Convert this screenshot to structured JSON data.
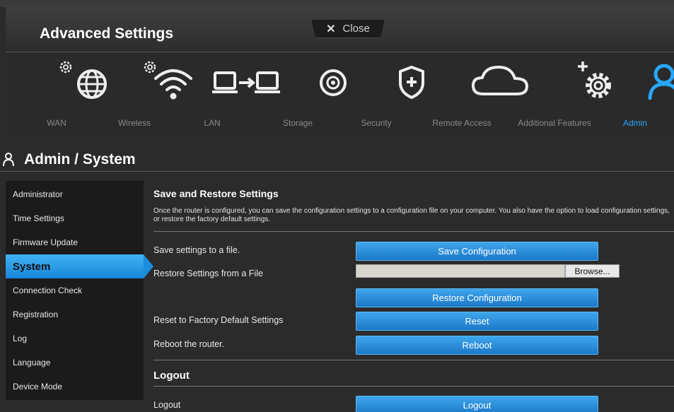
{
  "header": {
    "title": "Advanced Settings",
    "close_label": "Close",
    "close_glyph": "✕"
  },
  "nav": [
    {
      "label": "WAN",
      "icon": "globe-gear-icon",
      "active": false
    },
    {
      "label": "Wireless",
      "icon": "wifi-gear-icon",
      "active": false
    },
    {
      "label": "LAN",
      "icon": "lan-transfer-icon",
      "active": false
    },
    {
      "label": "Storage",
      "icon": "storage-disc-icon",
      "active": false
    },
    {
      "label": "Security",
      "icon": "shield-plus-icon",
      "active": false
    },
    {
      "label": "Remote Access",
      "icon": "cloud-icon",
      "active": false
    },
    {
      "label": "Additional Features",
      "icon": "gear-plus-icon",
      "active": false
    },
    {
      "label": "Admin",
      "icon": "user-icon",
      "active": true
    }
  ],
  "page": {
    "title": "Admin / System",
    "icon": "user-icon"
  },
  "sidebar": {
    "items": [
      {
        "label": "Administrator",
        "active": false
      },
      {
        "label": "Time Settings",
        "active": false
      },
      {
        "label": "Firmware Update",
        "active": false
      },
      {
        "label": "System",
        "active": true
      },
      {
        "label": "Connection Check",
        "active": false
      },
      {
        "label": "Registration",
        "active": false
      },
      {
        "label": "Log",
        "active": false
      },
      {
        "label": "Language",
        "active": false
      },
      {
        "label": "Device Mode",
        "active": false
      }
    ]
  },
  "content": {
    "save_restore": {
      "title": "Save and Restore Settings",
      "description": "Once the router is configured, you can save the configuration settings to a configuration file on your computer. You also have the option to load configuration settings, or restore the factory default settings.",
      "save_label": "Save settings to a file.",
      "save_button": "Save Configuration",
      "restore_label": "Restore Settings from a File",
      "file_value": "",
      "browse_button": "Browse...",
      "restore_button": "Restore Configuration",
      "reset_label": "Reset to Factory Default Settings",
      "reset_button": "Reset",
      "reboot_label": "Reboot the router.",
      "reboot_button": "Reboot"
    },
    "logout": {
      "title": "Logout",
      "label": "Logout",
      "button": "Logout"
    }
  },
  "colors": {
    "accent": "#27a7ff",
    "button": "#2a8ede",
    "background": "#2b2b2b",
    "sidebar": "#1b1b1b"
  }
}
